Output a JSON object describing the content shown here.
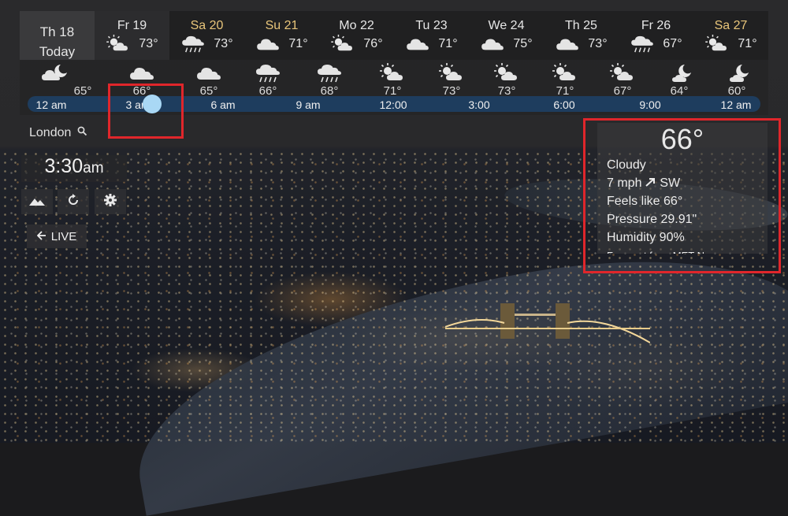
{
  "days": [
    {
      "name": "Th 18",
      "sub": "Today",
      "weekend": false,
      "today": true
    },
    {
      "name": "Fr 19",
      "temp": "73°",
      "icon": "sun-cloud-icon",
      "weekend": false
    },
    {
      "name": "Sa 20",
      "temp": "73°",
      "icon": "rain-cloud-icon",
      "weekend": true
    },
    {
      "name": "Su 21",
      "temp": "71°",
      "icon": "cloud-icon",
      "weekend": true
    },
    {
      "name": "Mo 22",
      "temp": "76°",
      "icon": "sun-cloud-icon",
      "weekend": false
    },
    {
      "name": "Tu 23",
      "temp": "71°",
      "icon": "cloud-icon",
      "weekend": false
    },
    {
      "name": "We 24",
      "temp": "75°",
      "icon": "cloud-icon",
      "weekend": false
    },
    {
      "name": "Th 25",
      "temp": "73°",
      "icon": "cloud-icon",
      "weekend": false
    },
    {
      "name": "Fr 26",
      "temp": "67°",
      "icon": "rain-cloud-icon",
      "weekend": false
    },
    {
      "name": "Sa 27",
      "temp": "71°",
      "icon": "sun-cloud-icon",
      "weekend": true
    }
  ],
  "hourly_temps": [
    "65°",
    "66°",
    "65°",
    "66°",
    "68°",
    "71°",
    "73°",
    "73°",
    "71°",
    "67°",
    "64°",
    "60°"
  ],
  "hourly_icons": [
    "cloud-moon-icon",
    "cloud-icon",
    "cloud-icon",
    "rain-cloud-icon",
    "rain-cloud-icon",
    "sun-cloud-icon",
    "sun-cloud-icon",
    "sun-cloud-icon",
    "sun-cloud-icon",
    "sun-cloud-icon",
    "moon-cloud-icon",
    "moon-cloud-icon"
  ],
  "time_labels": [
    "12 am",
    "3 am",
    "6 am",
    "9 am",
    "12:00",
    "3:00",
    "6:00",
    "9:00",
    "12 am"
  ],
  "selected_time_fraction": 0.17,
  "location": "London",
  "clock": {
    "time": "3:30",
    "ampm": "am"
  },
  "live_label": "LIVE",
  "detail": {
    "temp": "66°",
    "condition": "Cloudy",
    "wind": "7 mph",
    "wind_dir": "SW",
    "feels_like": "Feels like 66°",
    "pressure": "Pressure 29.91\"",
    "humidity": "Humidity 90%",
    "source": "Forecast from MET Norway"
  },
  "colors": {
    "accent": "#a9d8f5",
    "highlight": "#e0262b",
    "weekend": "#e8c57a",
    "timebar": "#1e3d5e"
  }
}
